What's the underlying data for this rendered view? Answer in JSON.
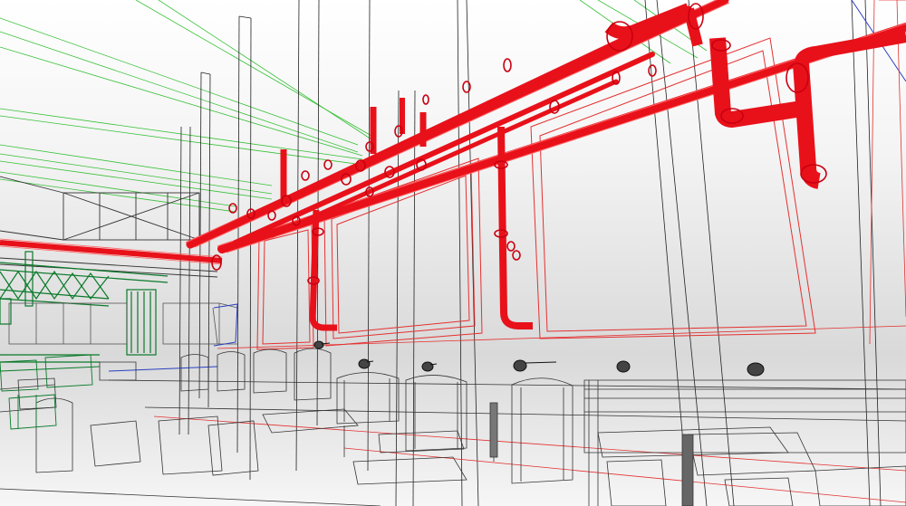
{
  "scene": {
    "subject": "bim-wireframe-restaurant-interior",
    "colors": {
      "background_top": "#ffffff",
      "background_mid": "#d9d9d9",
      "pipes": "#e8111a",
      "sprinkler_lines": "#22bb22",
      "framing": "#0a7a2a",
      "structure": "#222222",
      "furniture": "#333333",
      "frames": "#e53030",
      "accent_blue": "#2a3fbf"
    }
  }
}
